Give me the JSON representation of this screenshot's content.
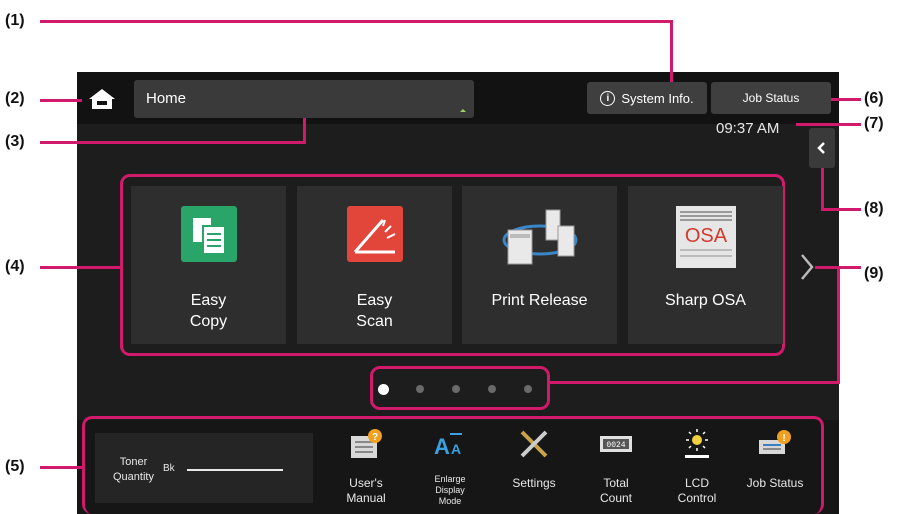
{
  "callouts": [
    "(1)",
    "(2)",
    "(3)",
    "(4)",
    "(5)",
    "(6)",
    "(7)",
    "(8)",
    "(9)"
  ],
  "header": {
    "title_value": "Home",
    "system_info_label": "System Info.",
    "job_status_label": "Job Status",
    "clock": "09:37 AM"
  },
  "tiles": [
    {
      "label": "Easy\nCopy",
      "icon": "copy-icon"
    },
    {
      "label": "Easy\nScan",
      "icon": "scan-icon"
    },
    {
      "label": "Print Release",
      "icon": "print-release-icon"
    },
    {
      "label": "Sharp OSA",
      "icon": "sharp-osa-icon"
    }
  ],
  "page_indicator": {
    "total": 5,
    "current": 1
  },
  "toner": {
    "label": "Toner\nQuantity",
    "color_label": "Bk"
  },
  "bottom_items": [
    {
      "label": "User's\nManual",
      "icon": "manual-icon"
    },
    {
      "label": "Enlarge\nDisplay\nMode",
      "icon": "enlarge-text-icon"
    },
    {
      "label": "Settings",
      "icon": "settings-icon"
    },
    {
      "label": "Total\nCount",
      "icon": "counter-icon"
    },
    {
      "label": "LCD\nControl",
      "icon": "brightness-icon"
    },
    {
      "label": "Job Status",
      "icon": "job-status-icon"
    }
  ],
  "colors": {
    "callout_line": "#d11a6b",
    "background": "#1d1d1d"
  }
}
